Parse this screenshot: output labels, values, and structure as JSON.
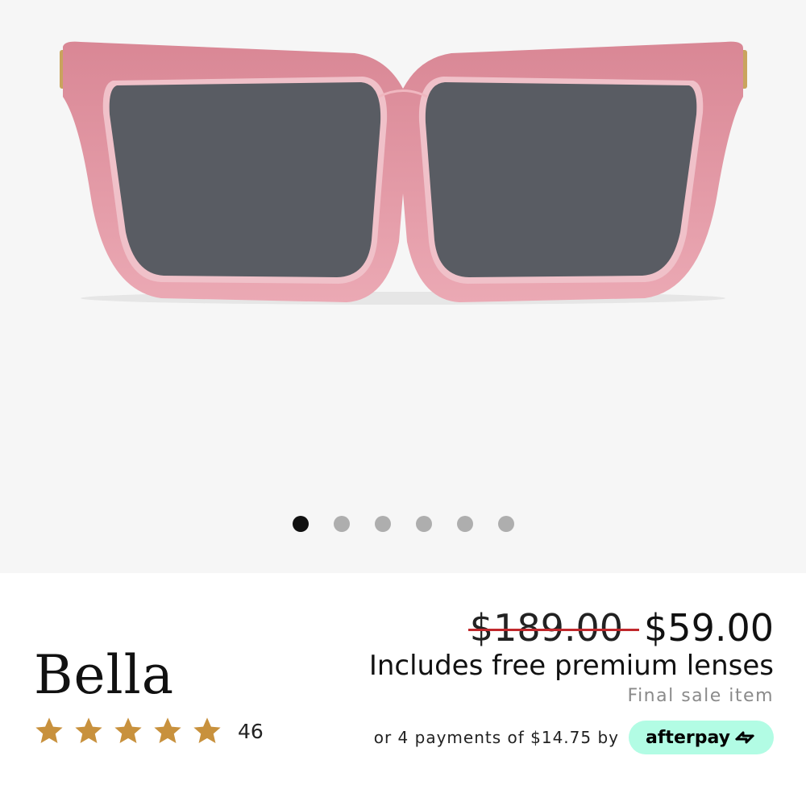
{
  "product": {
    "name": "Bella",
    "image_icon": "sunglasses-image",
    "frame_color": "#e39aa5",
    "lens_color": "#595c63",
    "gallery": {
      "dot_count": 6,
      "active_index": 0
    }
  },
  "rating": {
    "stars": 5,
    "count": "46",
    "star_color": "#c8913d"
  },
  "pricing": {
    "original": "$189.00",
    "sale": "$59.00",
    "includes": "Includes free premium lenses",
    "final_sale": "Final sale item"
  },
  "payments": {
    "text": "or 4 payments of $14.75 by",
    "brand": "afterpay",
    "brand_icon": "afterpay-arrows-icon",
    "brand_color": "#b2fce4"
  }
}
